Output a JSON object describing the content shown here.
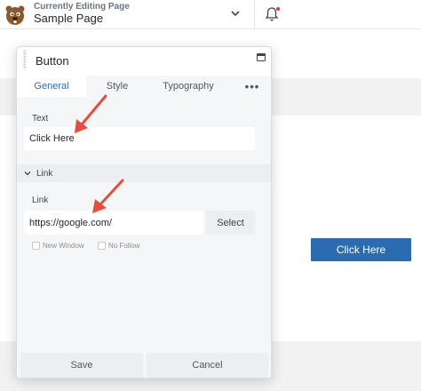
{
  "header": {
    "editing_label": "Currently Editing Page",
    "page_name": "Sample Page",
    "logo_icon": "beaver-logo-icon",
    "notification_icon": "bell-icon"
  },
  "panel": {
    "title": "Button",
    "tabs": [
      {
        "label": "General",
        "active": true
      },
      {
        "label": "Style",
        "active": false
      },
      {
        "label": "Typography",
        "active": false
      },
      {
        "label": "•••",
        "active": false
      }
    ],
    "text": {
      "label": "Text",
      "value": "Click Here"
    },
    "link_section": {
      "label": "Link",
      "field_label": "Link",
      "url_value": "https://google.com/",
      "select_label": "Select",
      "new_window_label": "New Window",
      "new_window_checked": false,
      "no_follow_label": "No Follow",
      "no_follow_checked": false
    },
    "footer": {
      "save_label": "Save",
      "cancel_label": "Cancel"
    }
  },
  "canvas": {
    "button_text": "Click Here"
  },
  "colors": {
    "accent": "#2b6cb0",
    "annotation_arrow": "#e74c3c",
    "notification_dot": "#e53935"
  }
}
